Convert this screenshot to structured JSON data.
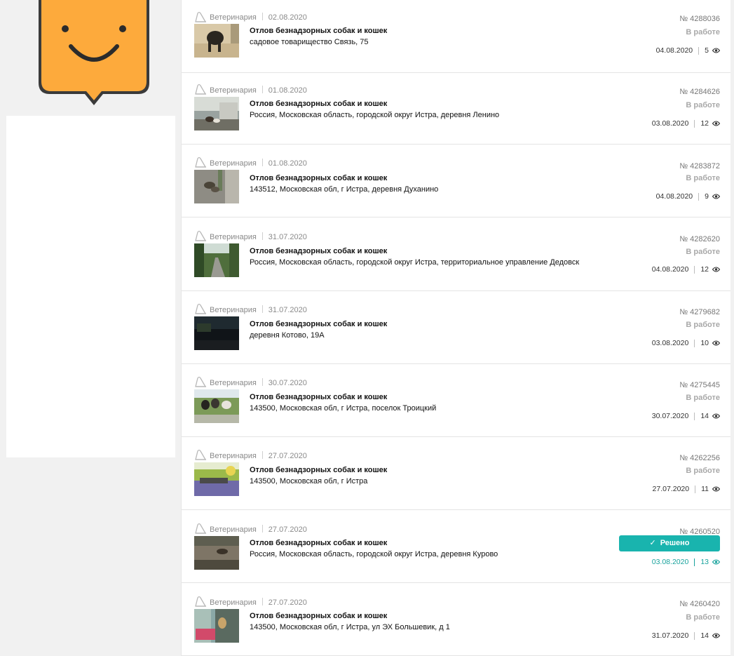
{
  "colors": {
    "accent": "#19b4ae",
    "logo": "#fdaa3c",
    "logo_outline": "#3a3a3a"
  },
  "items": [
    {
      "category": "Ветеринария",
      "date": "02.08.2020",
      "title": "Отлов безнадзорных собак и кошек",
      "address": "садовое товарищество Связь, 75",
      "number": "№ 4288036",
      "status": "В работе",
      "updated": "04.08.2020",
      "views": "5"
    },
    {
      "category": "Ветеринария",
      "date": "01.08.2020",
      "title": "Отлов безнадзорных собак и кошек",
      "address": "Россия, Московская область, городской округ Истра, деревня Ленино",
      "number": "№ 4284626",
      "status": "В работе",
      "updated": "03.08.2020",
      "views": "12"
    },
    {
      "category": "Ветеринария",
      "date": "01.08.2020",
      "title": "Отлов безнадзорных собак и кошек",
      "address": "143512, Московская обл, г Истра, деревня Духанино",
      "number": "№ 4283872",
      "status": "В работе",
      "updated": "04.08.2020",
      "views": "9"
    },
    {
      "category": "Ветеринария",
      "date": "31.07.2020",
      "title": "Отлов безнадзорных собак и кошек",
      "address": "Россия, Московская область, городской округ Истра, территориальное управление Дедовск",
      "number": "№ 4282620",
      "status": "В работе",
      "updated": "04.08.2020",
      "views": "12"
    },
    {
      "category": "Ветеринария",
      "date": "31.07.2020",
      "title": "Отлов безнадзорных собак и кошек",
      "address": "деревня Котово, 19А",
      "number": "№ 4279682",
      "status": "В работе",
      "updated": "03.08.2020",
      "views": "10"
    },
    {
      "category": "Ветеринария",
      "date": "30.07.2020",
      "title": "Отлов безнадзорных собак и кошек",
      "address": "143500, Московская обл, г Истра, поселок Троицкий",
      "number": "№ 4275445",
      "status": "В работе",
      "updated": "30.07.2020",
      "views": "14"
    },
    {
      "category": "Ветеринария",
      "date": "27.07.2020",
      "title": "Отлов безнадзорных собак и кошек",
      "address": "143500, Московская обл, г Истра",
      "number": "№ 4262256",
      "status": "В работе",
      "updated": "27.07.2020",
      "views": "11"
    },
    {
      "category": "Ветеринария",
      "date": "27.07.2020",
      "title": "Отлов безнадзорных собак и кошек",
      "address": "Россия, Московская область, городской округ Истра, деревня Курово",
      "number": "№ 4260520",
      "status": "Решено",
      "updated": "03.08.2020",
      "views": "13"
    },
    {
      "category": "Ветеринария",
      "date": "27.07.2020",
      "title": "Отлов безнадзорных собак и кошек",
      "address": "143500, Московская обл, г Истра, ул ЭХ Большевик, д 1",
      "number": "№ 4260420",
      "status": "В работе",
      "updated": "31.07.2020",
      "views": "14"
    }
  ]
}
